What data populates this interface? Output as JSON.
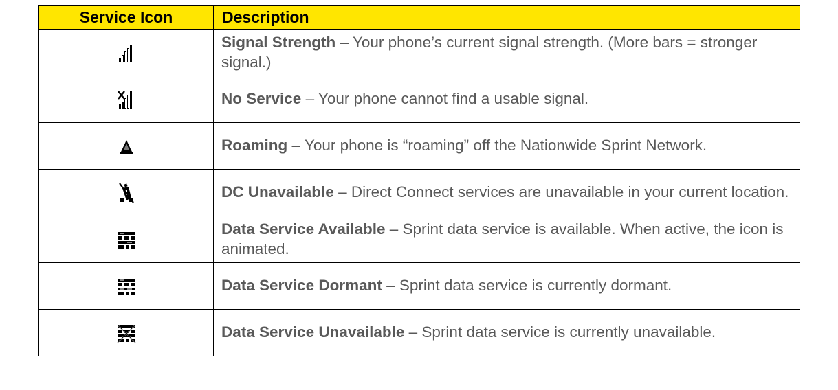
{
  "table": {
    "headers": {
      "icon": "Service Icon",
      "description": "Description"
    },
    "rows": [
      {
        "icon": "signal-strength-icon",
        "term": "Signal Strength",
        "text": " – Your phone’s current signal strength. (More bars = stronger signal.)"
      },
      {
        "icon": "no-service-icon",
        "term": "No Service",
        "text": " – Your phone cannot find a usable signal."
      },
      {
        "icon": "roaming-icon",
        "term": "Roaming",
        "text": " – Your phone is “roaming” off the Nationwide Sprint Network."
      },
      {
        "icon": "dc-unavailable-icon",
        "term": "DC Unavailable",
        "text": " – Direct Connect services are unavailable in your current location."
      },
      {
        "icon": "data-service-available-icon",
        "term": "Data Service Available",
        "text": " – Sprint data service is available. When active, the icon is animated."
      },
      {
        "icon": "data-service-dormant-icon",
        "term": "Data Service Dormant",
        "text": " – Sprint data service is currently dormant."
      },
      {
        "icon": "data-service-unavailable-icon",
        "term": "Data Service Unavailable",
        "text": " – Sprint data service is currently unavailable."
      }
    ]
  },
  "colors": {
    "header_background": "#ffe600",
    "body_text": "#595959",
    "border": "#000000"
  }
}
